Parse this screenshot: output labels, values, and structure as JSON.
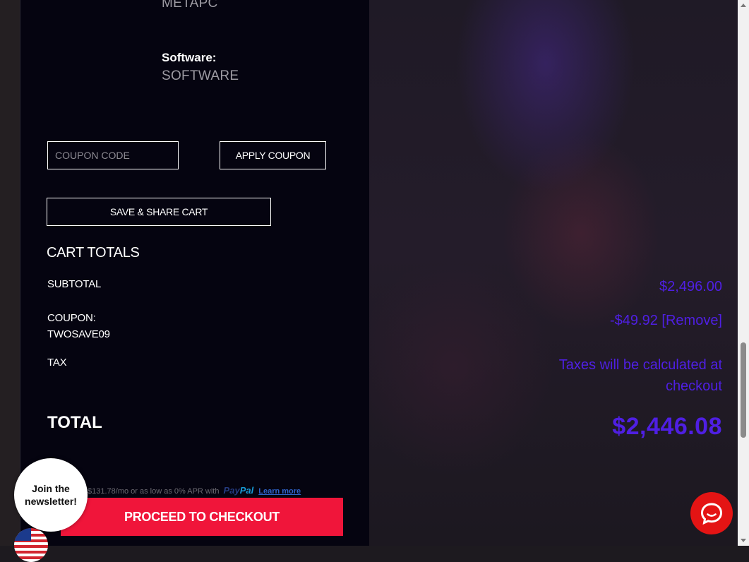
{
  "product": {
    "partial_value": "METAPC",
    "software_label": "Software:",
    "software_value": "SOFTWARE"
  },
  "coupon": {
    "placeholder": "COUPON CODE",
    "apply_label": "APPLY COUPON"
  },
  "share": {
    "label": "SAVE & SHARE CART"
  },
  "totals": {
    "heading": "CART TOTALS",
    "subtotal_label": "SUBTOTAL",
    "subtotal_value": "$2,496.00",
    "coupon_label": "COUPON:",
    "coupon_code": "TWOSAVE09",
    "coupon_value": "-$49.92",
    "remove_label": "[Remove]",
    "tax_label": "TAX",
    "tax_value_line1": "Taxes will be calculated at",
    "tax_value_line2": "checkout",
    "total_label": "TOTAL",
    "total_value": "$2,446.08"
  },
  "financing": {
    "text": "$131.78/mo or as low as 0% APR with",
    "paypal_pay": "Pay",
    "paypal_pal": "Pal",
    "learn_more": "Learn more"
  },
  "checkout": {
    "label": "PROCEED TO CHECKOUT"
  },
  "newsletter": {
    "line1": "Join the",
    "line2": "newsletter!"
  },
  "colors": {
    "accent_purple": "#4f1fe3",
    "checkout_red": "#f0153a",
    "panel_bg": "#050410",
    "chat_red": "#e41414"
  },
  "icons": {
    "chat": "chat-bubble-icon",
    "flag": "us-flag-icon"
  }
}
